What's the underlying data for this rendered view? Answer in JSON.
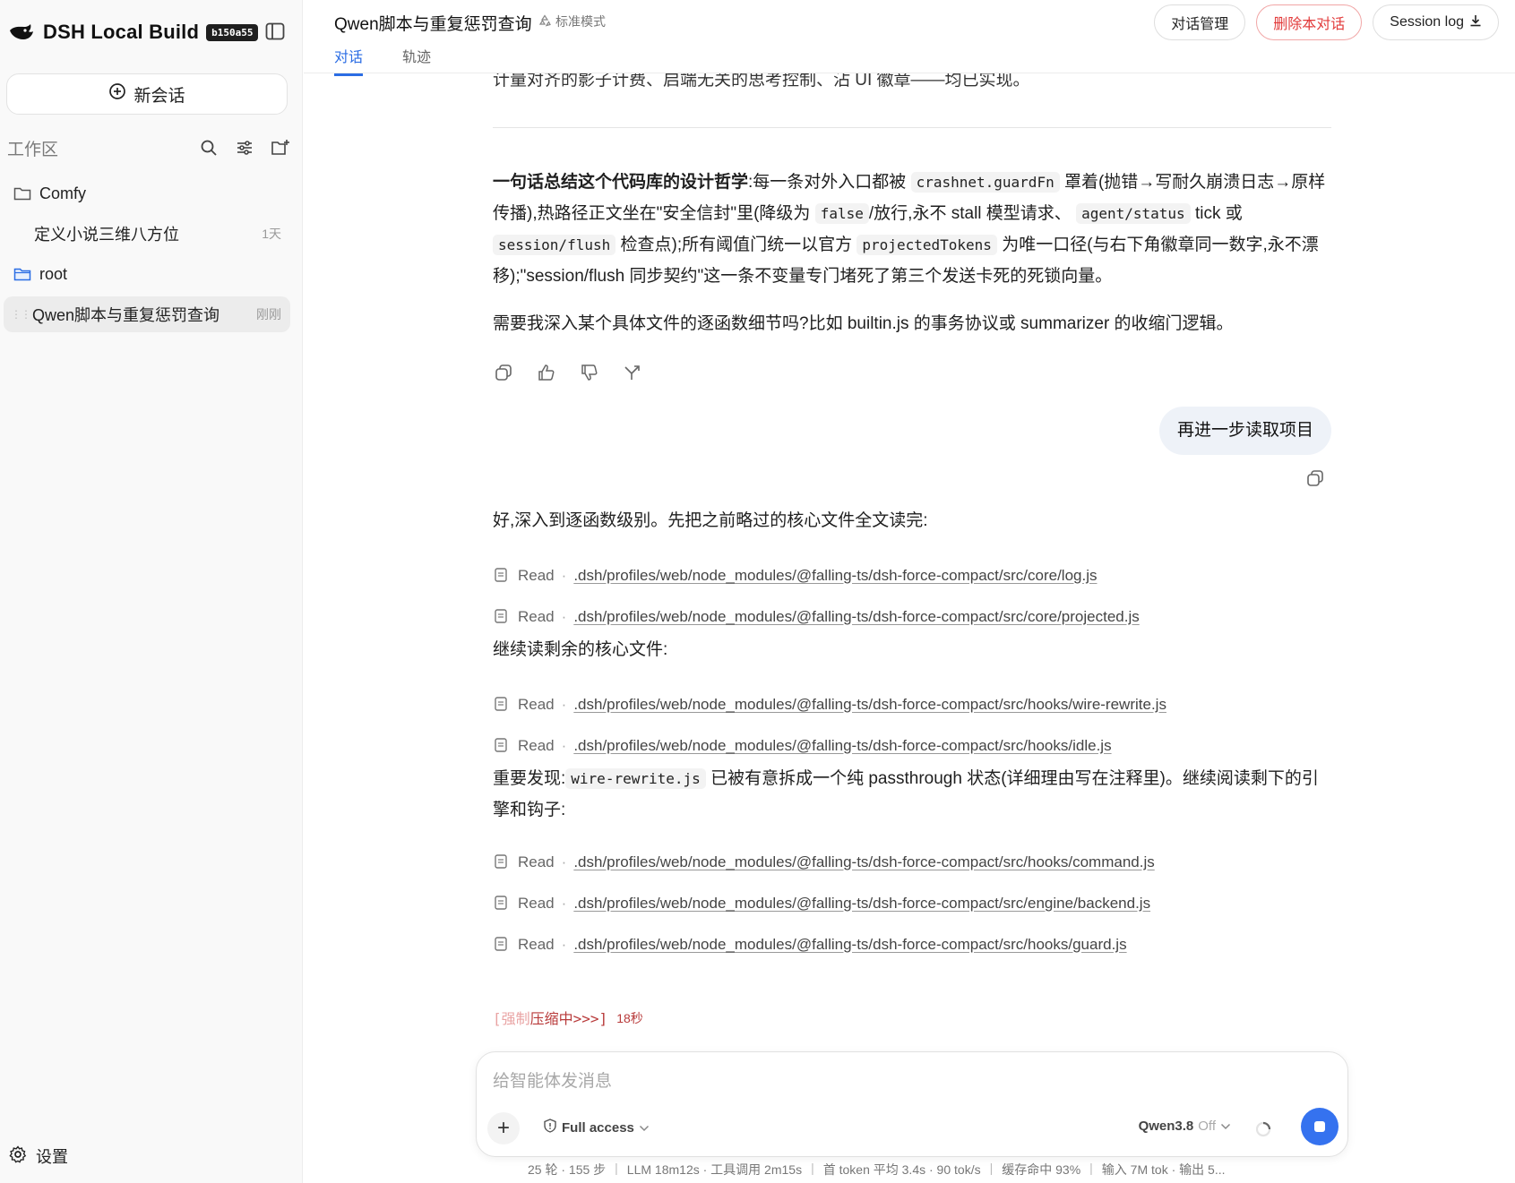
{
  "sidebar": {
    "brand": "DSH Local Build",
    "build_badge": "b150a55",
    "new_chat": "新会话",
    "workspace_title": "工作区",
    "items": [
      {
        "label": "Comfy",
        "time": "",
        "type": "folder"
      },
      {
        "label": "定义小说三维八方位",
        "time": "1天",
        "type": "chat"
      },
      {
        "label": "root",
        "time": "",
        "type": "folder"
      },
      {
        "label": "Qwen脚本与重复惩罚查询",
        "time": "刚刚",
        "type": "chat"
      }
    ],
    "settings": "设置"
  },
  "topbar": {
    "title": "Qwen脚本与重复惩罚查询",
    "mode": "标准模式",
    "tabs": [
      "对话",
      "轨迹"
    ],
    "manage": "对话管理",
    "delete": "删除本对话",
    "session_log": "Session log"
  },
  "content": {
    "top_cut": "计量对齐的影子计费、启端无关的思考控制、沾 UI 徽章——均已实现。",
    "summary_bold": "一句话总结这个代码库的设计哲学",
    "summary_1": ":每一条对外入口都被",
    "code_guard": "crashnet.guardFn",
    "summary_2": "罩着(抛错→写耐久崩溃日志→原样传播),热路径正文坐在\"安全信封\"里(降级为",
    "code_false": "false",
    "summary_3": "/放行,永不 stall 模型请求、",
    "code_agent": "agent/status",
    "summary_4": "tick 或",
    "code_session": "session/flush",
    "summary_5": "检查点);所有阈值门统一以官方",
    "code_projected": "projectedTokens",
    "summary_6": "为唯一口径(与右下角徽章同一数字,永不漂移);\"session/flush 同步契约\"这一条不变量专门堵死了第三个发送卡死的死锁向量。",
    "question": "需要我深入某个具体文件的逐函数细节吗?比如 builtin.js 的事务协议或 summarizer 的收缩门逻辑。",
    "user_message": "再进一步读取项目",
    "reply_intro": "好,深入到逐函数级别。先把之前略过的核心文件全文读完:",
    "read_label": "Read",
    "reads_1": [
      ".dsh/profiles/web/node_modules/@falling-ts/dsh-force-compact/src/core/log.js",
      ".dsh/profiles/web/node_modules/@falling-ts/dsh-force-compact/src/core/projected.js"
    ],
    "continue_text": "继续读剩余的核心文件:",
    "reads_2": [
      ".dsh/profiles/web/node_modules/@falling-ts/dsh-force-compact/src/hooks/wire-rewrite.js",
      ".dsh/profiles/web/node_modules/@falling-ts/dsh-force-compact/src/hooks/idle.js"
    ],
    "finding_1": "重要发现:",
    "code_wire": "wire-rewrite.js",
    "finding_2": "已被有意拆成一个纯 passthrough 状态(详细理由写在注释里)。继续阅读剩下的引擎和钩子:",
    "reads_3": [
      ".dsh/profiles/web/node_modules/@falling-ts/dsh-force-compact/src/hooks/command.js",
      ".dsh/profiles/web/node_modules/@falling-ts/dsh-force-compact/src/engine/backend.js",
      ".dsh/profiles/web/node_modules/@falling-ts/dsh-force-compact/src/hooks/guard.js"
    ],
    "status_faded": "[强制",
    "status_main": "压缩中>>>]",
    "status_time": "18秒"
  },
  "composer": {
    "placeholder": "给智能体发消息",
    "access": "Full access",
    "model": "Qwen3.8",
    "model_thinking": "Off"
  },
  "footer": {
    "stats": [
      "25 轮 · 155 步",
      "LLM 18m12s · 工具调用 2m15s",
      "首 token 平均 3.4s · 90 tok/s",
      "缓存命中 93%",
      "输入 7M tok · 输出 5..."
    ]
  },
  "colors": {
    "accent": "#2b6de4",
    "danger": "#e23b3b",
    "send": "#3572ef"
  }
}
